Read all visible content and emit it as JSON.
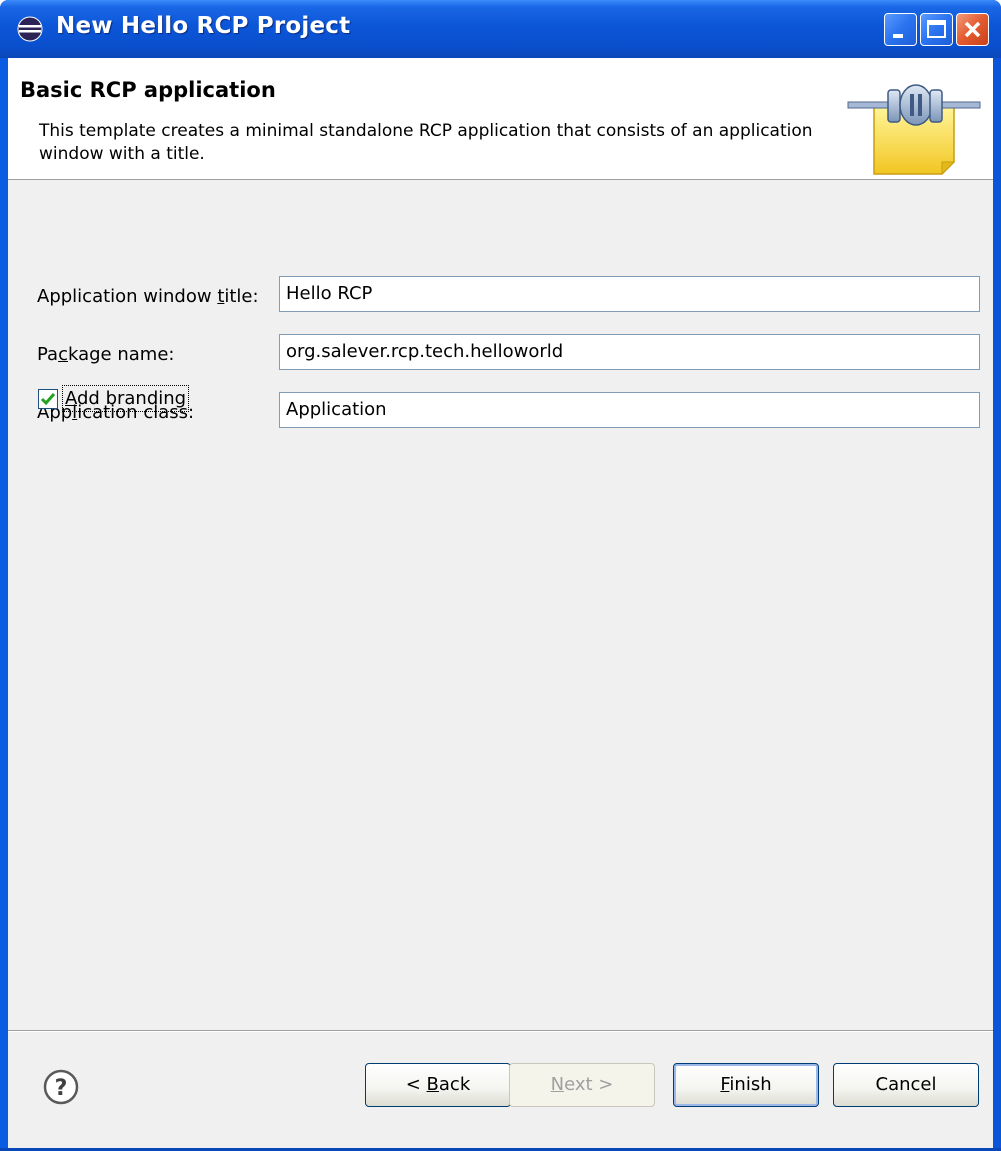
{
  "window": {
    "title": "New Hello RCP Project",
    "title_icon": "eclipse-icon",
    "controls": [
      "minimize-icon",
      "maximize-icon",
      "close-icon"
    ]
  },
  "header": {
    "title": "Basic RCP application",
    "description": "This template creates a minimal standalone RCP application that consists of an application window with a title.",
    "banner_icon": "wizard-plugin-banner-icon"
  },
  "fields": [
    {
      "label_pre": "Application window ",
      "label_mnemonic": "t",
      "label_post": "itle:",
      "value": "Hello RCP"
    },
    {
      "label_pre": "Pa",
      "label_mnemonic": "c",
      "label_post": "kage name:",
      "value": "org.salever.rcp.tech.helloworld"
    },
    {
      "label_pre": "App",
      "label_mnemonic": "l",
      "label_post": "ication class:",
      "value": "Application"
    }
  ],
  "branding": {
    "checked": true,
    "label_mnemonic": "A",
    "label_post": "dd branding"
  },
  "buttons": {
    "back": {
      "pre": "< ",
      "mnemonic": "B",
      "post": "ack",
      "enabled": true
    },
    "next": {
      "pre": "",
      "mnemonic": "N",
      "post": "ext >",
      "enabled": false
    },
    "finish": {
      "pre": "",
      "mnemonic": "F",
      "post": "inish",
      "enabled": true
    },
    "cancel": {
      "label": "Cancel",
      "enabled": true
    }
  },
  "help_icon": "help-question-icon",
  "colors": {
    "titlebar": "#0a56d8",
    "client_bg": "#f0f0f0",
    "input_border": "#7f9db9"
  }
}
